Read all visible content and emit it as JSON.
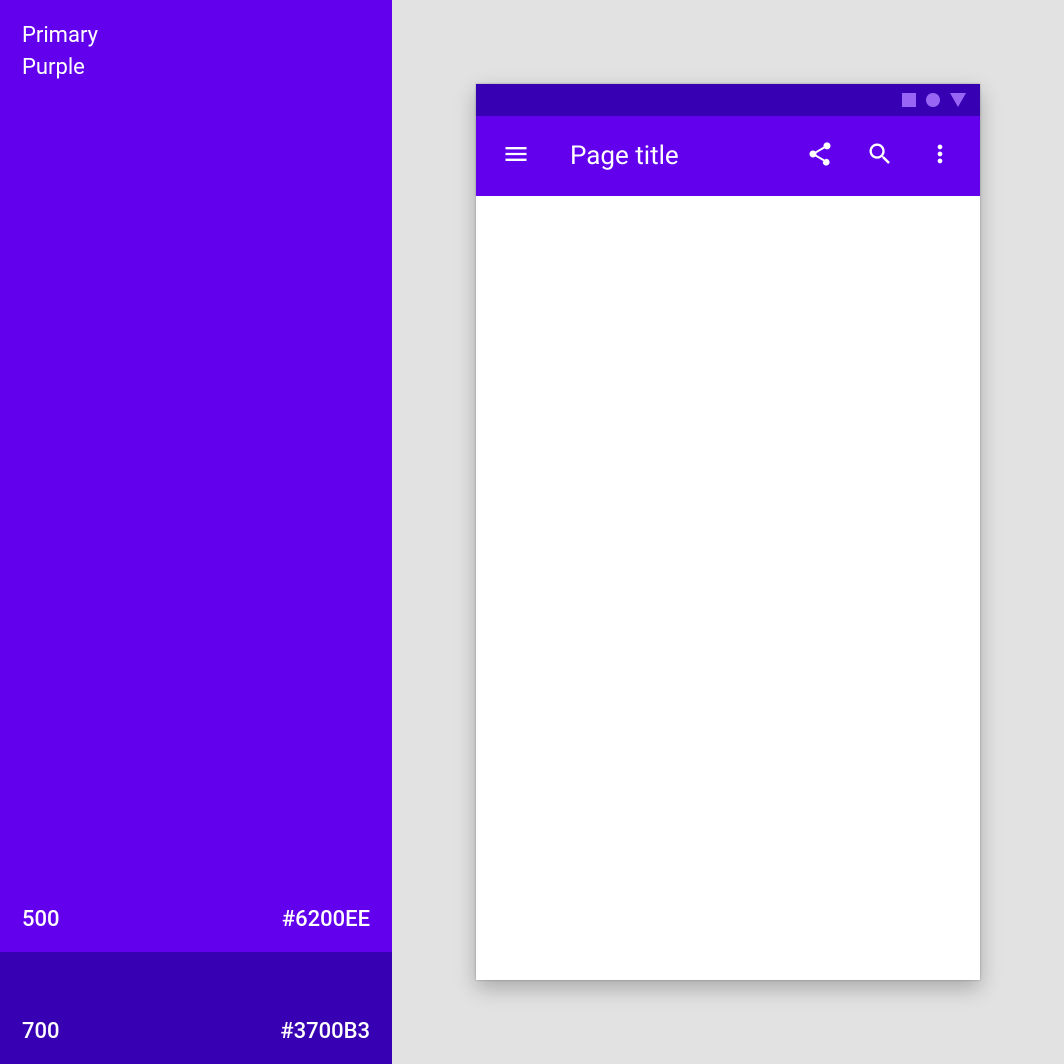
{
  "palette": {
    "primary_label": "Primary",
    "color_name": "Purple",
    "swatches": [
      {
        "tone": "500",
        "hex": "#6200EE"
      },
      {
        "tone": "700",
        "hex": "#3700B3"
      }
    ]
  },
  "preview": {
    "page_title": "Page title",
    "colors": {
      "status_bar": "#3700B3",
      "app_bar": "#6200EE",
      "status_icons": "#9965f4"
    }
  }
}
